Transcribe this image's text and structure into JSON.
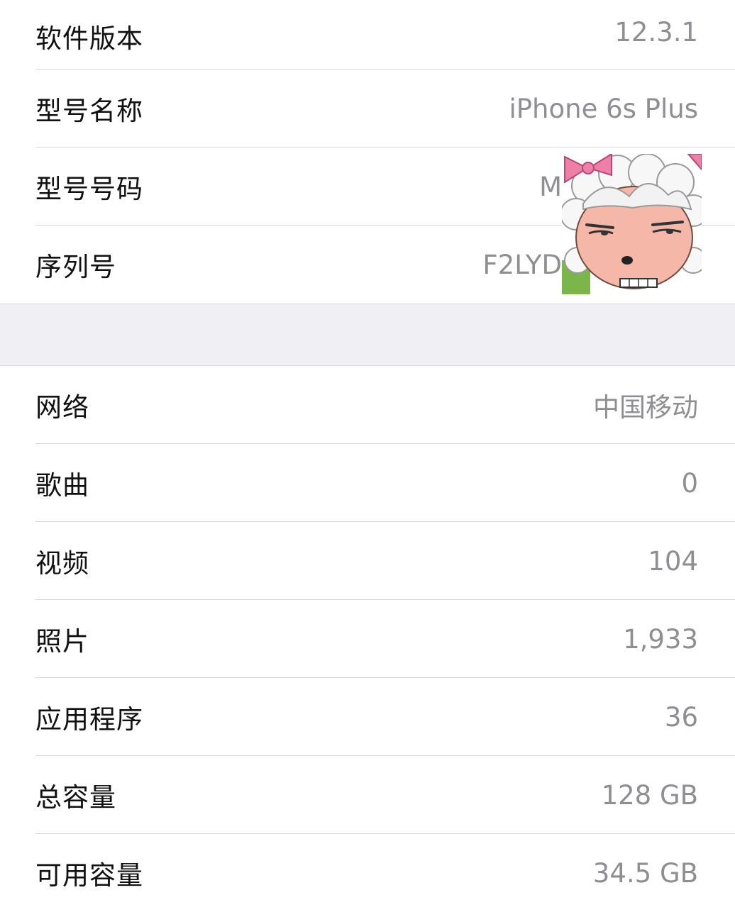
{
  "about": {
    "rows_top": [
      {
        "label": "软件版本",
        "value": "12.3.1"
      },
      {
        "label": "型号名称",
        "value": "iPhone 6s Plus"
      },
      {
        "label": "型号号码",
        "value": "M"
      },
      {
        "label": "序列号",
        "value": "F2LYD"
      }
    ],
    "rows_bottom": [
      {
        "label": "网络",
        "value": "中国移动"
      },
      {
        "label": "歌曲",
        "value": "0"
      },
      {
        "label": "视频",
        "value": "104"
      },
      {
        "label": "照片",
        "value": "1,933"
      },
      {
        "label": "应用程序",
        "value": "36"
      },
      {
        "label": "总容量",
        "value": "128 GB"
      },
      {
        "label": "可用容量",
        "value": "34.5 GB"
      }
    ]
  },
  "sticker": {
    "name": "sheep-cartoon-sticker"
  },
  "colors": {
    "background": "#ffffff",
    "group_separator": "#efeff4",
    "label_text": "#111111",
    "value_text": "#8e8e93",
    "divider": "#d7d7dc"
  }
}
